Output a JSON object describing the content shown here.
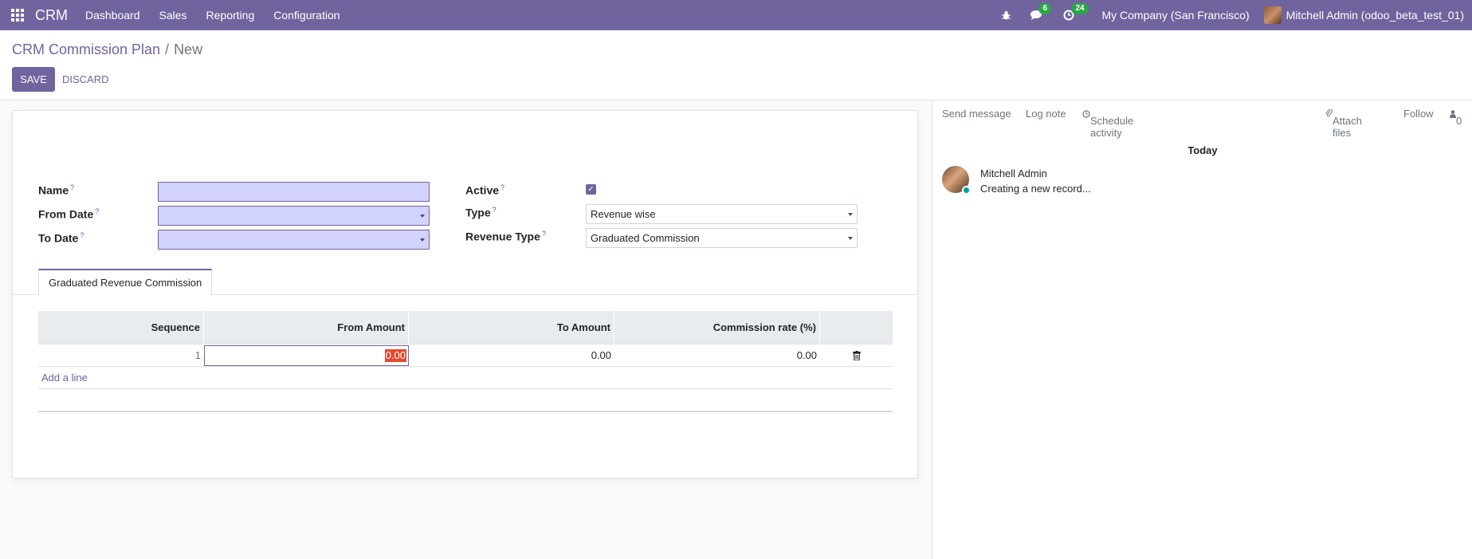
{
  "navbar": {
    "brand": "CRM",
    "menus": [
      "Dashboard",
      "Sales",
      "Reporting",
      "Configuration"
    ],
    "messages_count": "6",
    "activities_count": "24",
    "company": "My Company (San Francisco)",
    "user": "Mitchell Admin (odoo_beta_test_01)"
  },
  "control": {
    "breadcrumb_parent": "CRM Commission Plan",
    "breadcrumb_separator": "/",
    "breadcrumb_current": "New",
    "save_label": "SAVE",
    "discard_label": "DISCARD"
  },
  "form": {
    "name_label": "Name",
    "from_date_label": "From Date",
    "to_date_label": "To Date",
    "active_label": "Active",
    "type_label": "Type",
    "type_value": "Revenue wise",
    "revenue_type_label": "Revenue Type",
    "revenue_type_value": "Graduated Commission",
    "help_mark": "?"
  },
  "tab": {
    "label": "Graduated Revenue Commission"
  },
  "table": {
    "headers": [
      "Sequence",
      "From Amount",
      "To Amount",
      "Commission rate (%)"
    ],
    "rows": [
      {
        "sequence": "1",
        "from_amount": "0.00",
        "to_amount": "0.00",
        "commission_rate": "0.00"
      }
    ],
    "add_line": "Add a line"
  },
  "chatter": {
    "send_message": "Send message",
    "log_note": "Log note",
    "schedule_activity": "Schedule activity",
    "attach_files": "Attach files",
    "follow": "Follow",
    "followers_count": "0",
    "date_separator": "Today",
    "message_author": "Mitchell Admin",
    "message_body": "Creating a new record..."
  },
  "colors": {
    "primary": "#71639e",
    "input_bg": "#d2d2ff",
    "selection": "#e34a2f",
    "online": "#00a09d"
  }
}
